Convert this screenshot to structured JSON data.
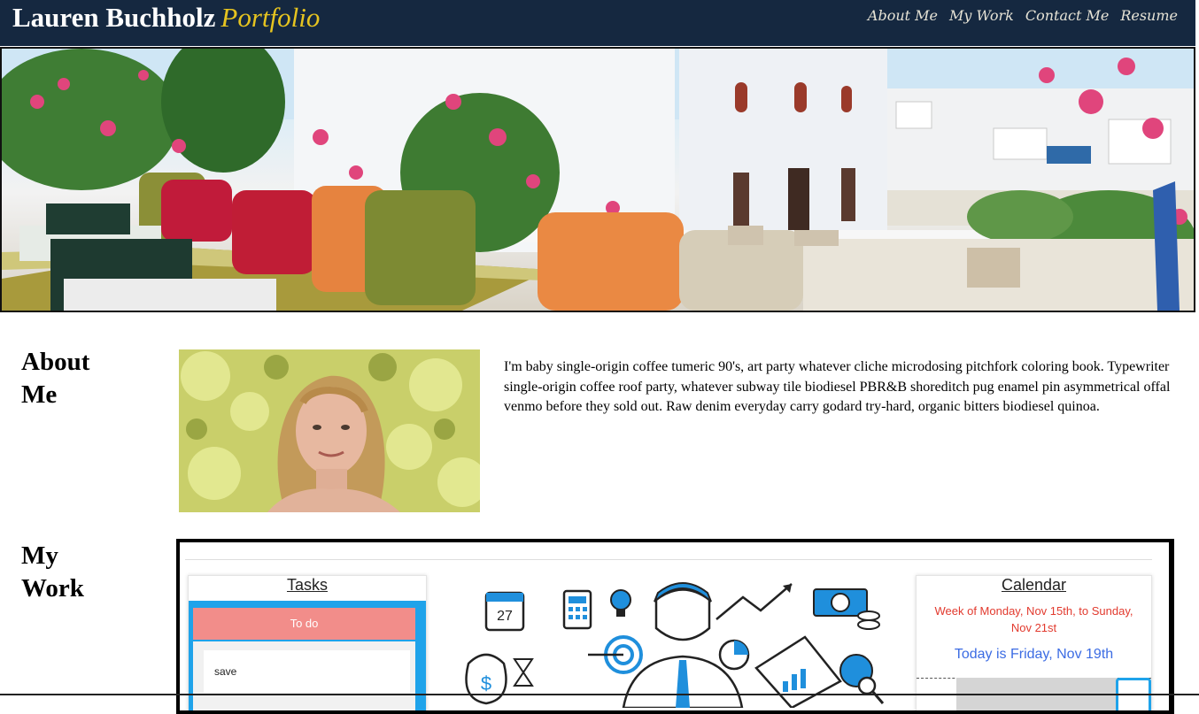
{
  "header": {
    "name": "Lauren Buchholz",
    "accent": "Portfolio",
    "nav": [
      "About Me",
      "My Work",
      "Contact Me",
      "Resume"
    ]
  },
  "colors": {
    "header_bg": "#152840",
    "accent": "#e6c420",
    "nav_text": "#e6e3d6",
    "todo": "#f28d8a",
    "tasks_blue": "#1fa3ea",
    "calendar_red": "#e23a2e",
    "calendar_blue": "#3c6ce3"
  },
  "about": {
    "title_line1": "About",
    "title_line2": "Me",
    "text": "I'm baby single-origin coffee tumeric 90's, art party whatever cliche microdosing pitchfork coloring book. Typewriter single-origin coffee roof party, whatever subway tile biodiesel PBR&B shoreditch pug enamel pin asymmetrical offal venmo before they sold out. Raw denim everyday carry godard try-hard, organic bitters biodiesel quinoa."
  },
  "work": {
    "title_line1": "My",
    "title_line2": "Work",
    "screenshot": {
      "tasks_title": "Tasks",
      "todo_label": "To do",
      "task_item": "save",
      "calendar_title": "Calendar",
      "calendar_week": "Week of Monday, Nov 15th, to Sunday, Nov 21st",
      "calendar_today": "Today is Friday, Nov 19th",
      "illustration_day": "27"
    }
  }
}
